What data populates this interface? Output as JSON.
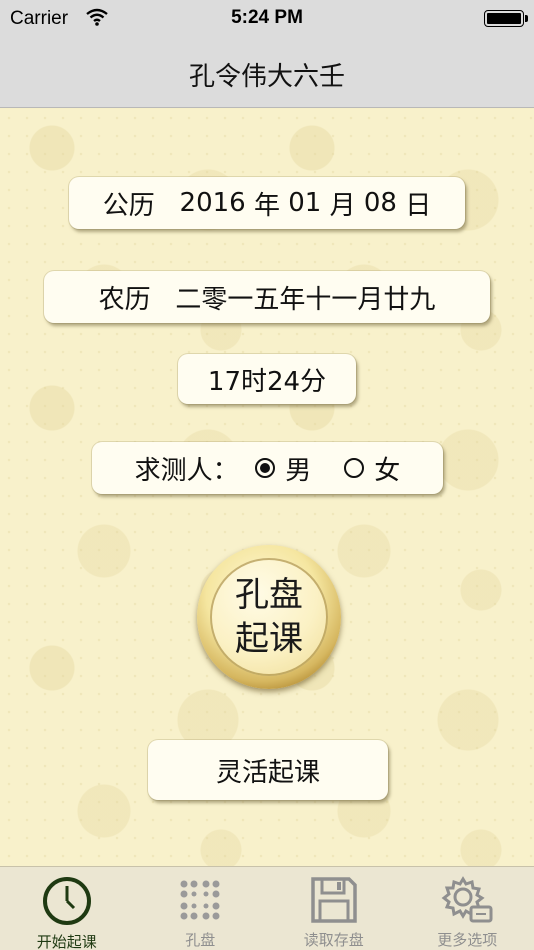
{
  "status_bar": {
    "carrier": "Carrier",
    "time": "5:24 PM"
  },
  "nav": {
    "title": "孔令伟大六壬"
  },
  "solar": {
    "label": "公历",
    "year": "2016",
    "year_unit": "年",
    "month": "01",
    "month_unit": "月",
    "day": "08",
    "day_unit": "日"
  },
  "lunar": {
    "label": "农历",
    "value": "二零一五年十一月廿九"
  },
  "time_card": {
    "value": "17时24分"
  },
  "gender": {
    "label": "求测人：",
    "male": "男",
    "female": "女",
    "selected": "male"
  },
  "main_button": {
    "line1": "孔盘",
    "line2": "起课"
  },
  "flex_button": {
    "label": "灵活起课"
  },
  "tabs": [
    {
      "label": "开始起课",
      "icon": "clock-icon",
      "active": true
    },
    {
      "label": "孔盘",
      "icon": "grid-icon",
      "active": false
    },
    {
      "label": "读取存盘",
      "icon": "floppy-disk-icon",
      "active": false
    },
    {
      "label": "更多选项",
      "icon": "gear-icon",
      "active": false
    }
  ],
  "colors": {
    "active_tab": "#1f3a12",
    "inactive_tab": "#8f8f8f",
    "background": "#f8f1cb"
  }
}
